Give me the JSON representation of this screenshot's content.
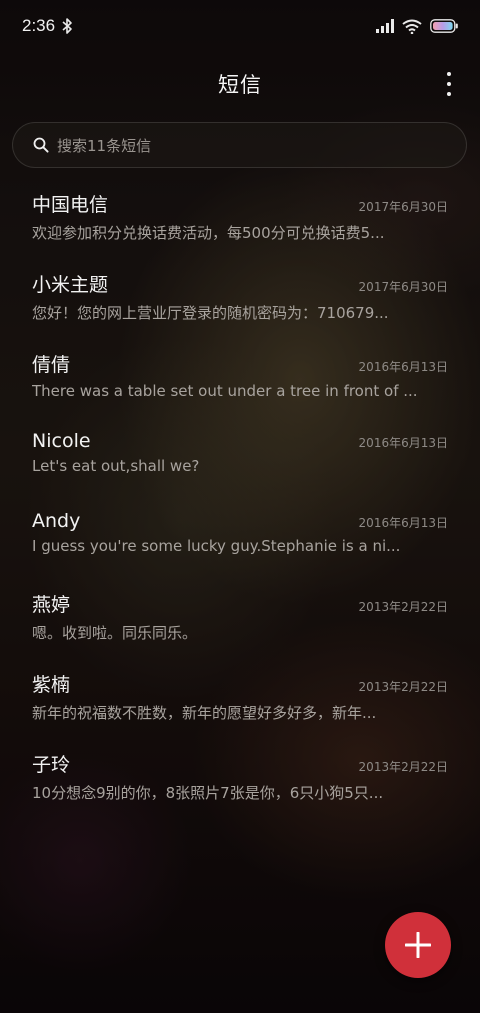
{
  "status_bar": {
    "time": "2:36",
    "icons": [
      "bluetooth-icon",
      "signal-icon",
      "wifi-icon",
      "battery-icon"
    ]
  },
  "header": {
    "title": "短信",
    "menu_icon": "more-vertical-icon"
  },
  "search": {
    "placeholder": "搜索11条短信",
    "icon": "search-icon"
  },
  "messages": [
    {
      "sender": "中国电信",
      "date": "2017年6月30日",
      "preview": "欢迎参加积分兑换话费活动，每500分可兑换话费5..."
    },
    {
      "sender": "小米主题",
      "date": "2017年6月30日",
      "preview": "您好！您的网上营业厅登录的随机密码为：710679..."
    },
    {
      "sender": "倩倩",
      "date": "2016年6月13日",
      "preview": "There was a table set out under a tree in front of ..."
    },
    {
      "sender": "Nicole",
      "date": "2016年6月13日",
      "preview": "Let's eat out,shall we?"
    },
    {
      "sender": "Andy",
      "date": "2016年6月13日",
      "preview": "I guess you're some lucky guy.Stephanie is a ni..."
    },
    {
      "sender": "燕婷",
      "date": "2013年2月22日",
      "preview": "嗯。收到啦。同乐同乐。"
    },
    {
      "sender": "紫楠",
      "date": "2013年2月22日",
      "preview": "新年的祝福数不胜数，新年的愿望好多好多，新年..."
    },
    {
      "sender": "子玲",
      "date": "2013年2月22日",
      "preview": "10分想念9别的你，8张照片7张是你，6只小狗5只..."
    }
  ],
  "fab": {
    "icon": "plus-icon",
    "color": "#d0303a"
  }
}
